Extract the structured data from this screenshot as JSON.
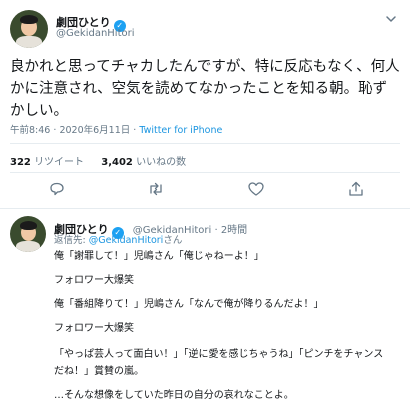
{
  "main_tweet": {
    "author_name": "劇団ひとり",
    "handle": "@GekidanHitori",
    "text": "良かれと思ってチャカしたんですが、特に反応もなく、何人かに注意され、空気を読めてなかったことを知る朝。恥ずかしい。",
    "time": "午前8:46",
    "date": "2020年6月11日",
    "separator": "·",
    "source": "Twitter for iPhone",
    "retweets_count": "322",
    "retweets_label": "リツイート",
    "likes_count": "3,402",
    "likes_label": "いいねの数"
  },
  "reply_tweet": {
    "author_name": "劇団ひとり",
    "handle_time": "@GekidanHitori · 2時間",
    "reply_prefix": "返信先: ",
    "reply_mention": "@GekidanHitori",
    "reply_suffix": "さん",
    "lines": [
      "俺「謝罪して！」児嶋さん「俺じゃねーよ！」",
      "フォロワー大爆笑",
      "俺「番組降りて！」児嶋さん「なんで俺が降りるんだよ！」",
      "フォロワー大爆笑",
      "「やっぱ芸人って面白い！」「逆に愛を感じちゃうね」「ピンチをチャンス",
      "だね！」賞賛の嵐。",
      "…そんな想像をしていた昨日の自分の哀れなことよ。"
    ]
  },
  "icons": {
    "verified": "verified-badge-icon",
    "chevron": "chevron-down-icon",
    "reply": "reply-icon",
    "retweet": "retweet-icon",
    "like": "heart-icon",
    "share": "share-icon"
  },
  "colors": {
    "link": "#1b95e0",
    "verified": "#1da1f2",
    "muted": "#657786",
    "text": "#14171a"
  }
}
